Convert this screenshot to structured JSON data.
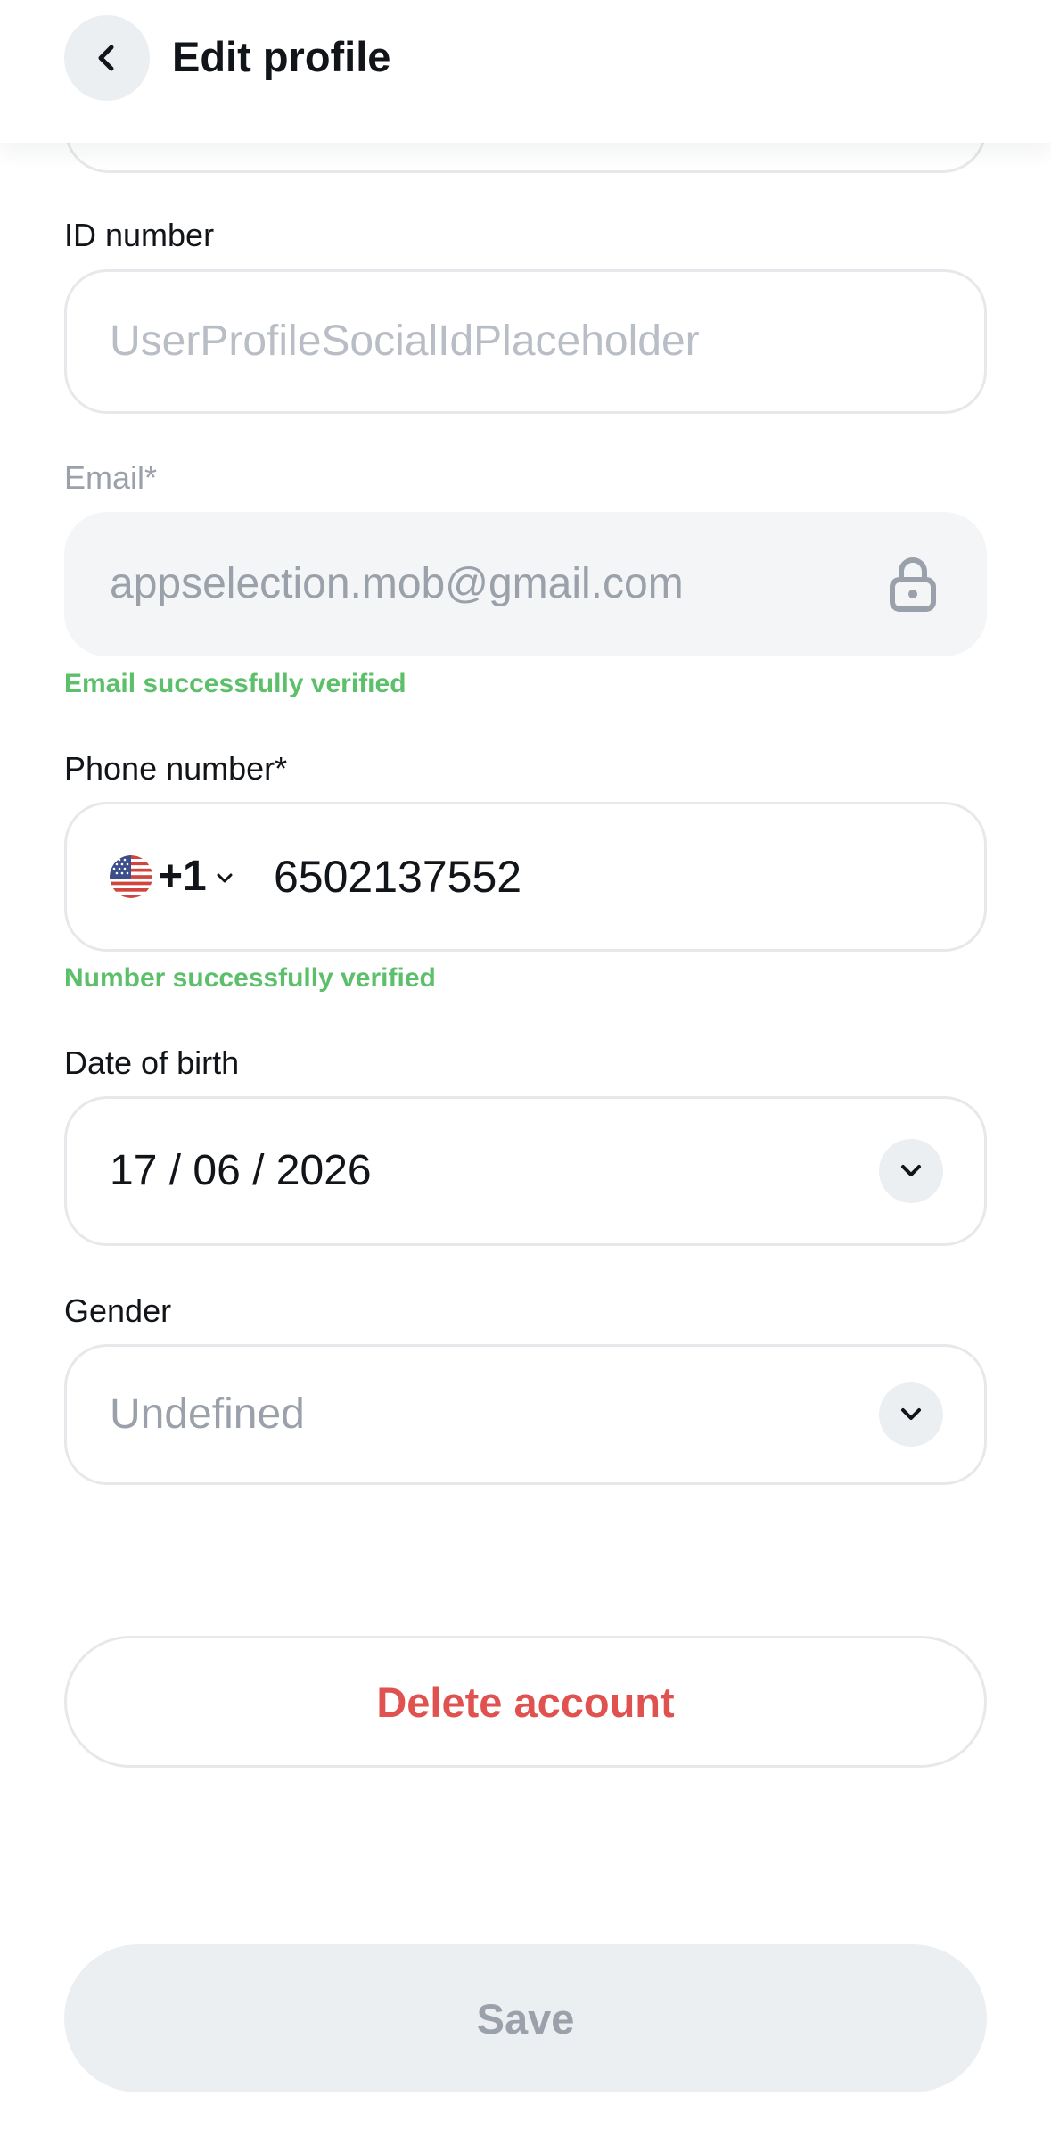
{
  "header": {
    "title": "Edit profile",
    "back_icon": "chevron-left-icon"
  },
  "fields": {
    "id_number": {
      "label": "ID number",
      "placeholder": "UserProfileSocialIdPlaceholder",
      "value": ""
    },
    "email": {
      "label": "Email*",
      "value": "appselection.mob@gmail.com",
      "icon": "lock-icon",
      "status": "Email successfully verified"
    },
    "phone": {
      "label": "Phone number*",
      "country_flag": "us-flag-icon",
      "dial_code": "+1",
      "value": "6502137552",
      "status": "Number successfully verified"
    },
    "date_of_birth": {
      "label": "Date of birth",
      "value": "17 / 06 / 2026",
      "icon": "chevron-down-icon"
    },
    "gender": {
      "label": "Gender",
      "value": "Undefined",
      "icon": "chevron-down-icon"
    }
  },
  "actions": {
    "delete_label": "Delete account",
    "save_label": "Save"
  },
  "colors": {
    "success": "#5cbf6a",
    "danger": "#e0524f",
    "muted": "#9aa1aa",
    "border": "#e6e8eb",
    "disabled_bg": "#eceff2"
  }
}
